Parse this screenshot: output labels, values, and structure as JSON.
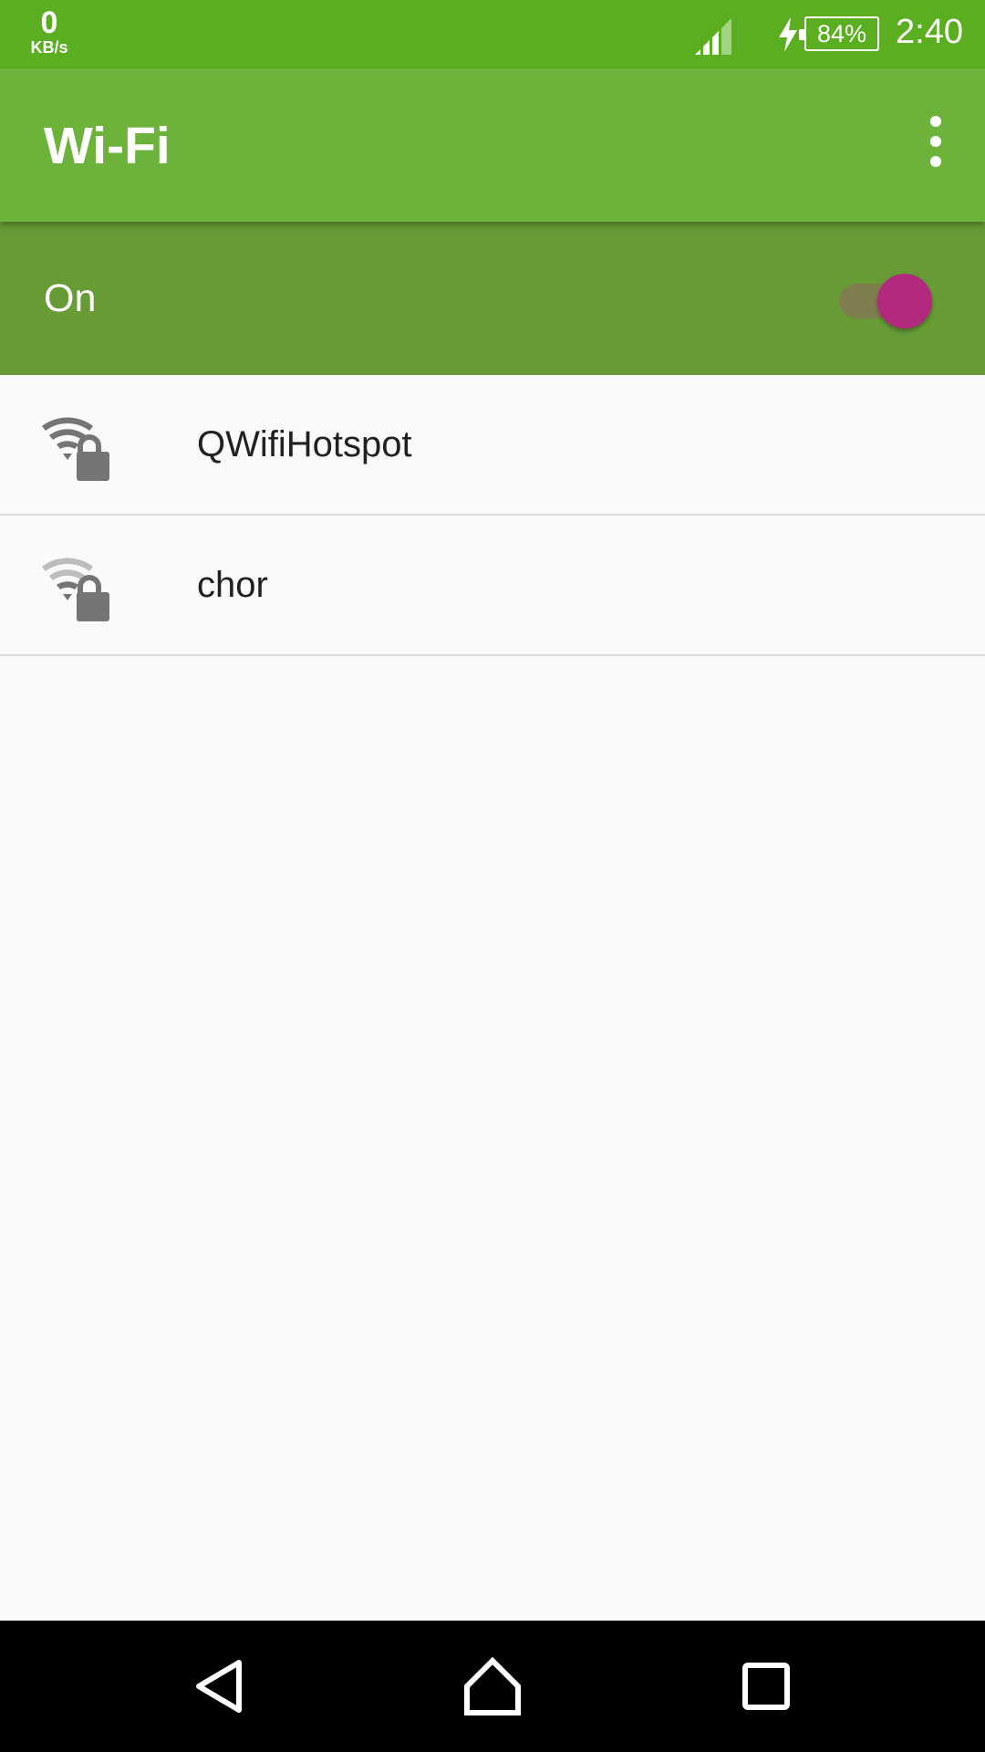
{
  "status_bar": {
    "net_speed_value": "0",
    "net_speed_unit": "KB/s",
    "battery_percent": "84%",
    "time": "2:40",
    "icons": [
      "cell-signal-icon",
      "charging-bolt-icon",
      "battery-icon"
    ]
  },
  "app_bar": {
    "title": "Wi-Fi",
    "overflow_icon": "more-vert-icon"
  },
  "wifi_switch": {
    "label": "On",
    "checked": true,
    "thumb_color": "#b3297e"
  },
  "networks": [
    {
      "ssid": "QWifiHotspot",
      "secured": true,
      "signal_level": 4,
      "icon": "wifi-lock-icon"
    },
    {
      "ssid": "chor",
      "secured": true,
      "signal_level": 2,
      "icon": "wifi-lock-icon"
    }
  ],
  "nav_bar": {
    "buttons": [
      "back-icon",
      "home-icon",
      "recents-icon"
    ]
  },
  "colors": {
    "status_bar": "#5aae20",
    "app_bar": "#6db23a",
    "switch_bar": "#679b36",
    "accent": "#b3297e"
  }
}
